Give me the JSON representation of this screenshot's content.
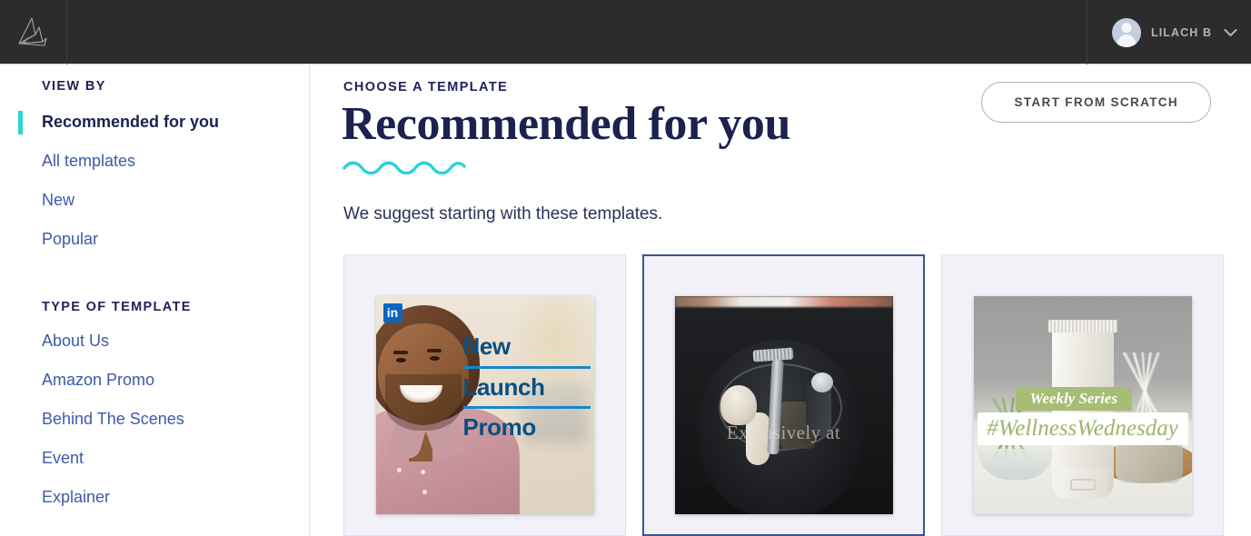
{
  "topbar": {
    "logo_icon": "paper-plane-logo",
    "user_name": "LILACH B",
    "chevron_icon": "chevron-down-icon",
    "avatar_icon": "user-avatar-placeholder"
  },
  "sidebar": {
    "view_by_heading": "VIEW BY",
    "view_by_items": [
      {
        "label": "Recommended for you",
        "active": true
      },
      {
        "label": "All templates",
        "active": false
      },
      {
        "label": "New",
        "active": false
      },
      {
        "label": "Popular",
        "active": false
      }
    ],
    "type_heading": "TYPE OF TEMPLATE",
    "type_items": [
      {
        "label": "About Us"
      },
      {
        "label": "Amazon Promo"
      },
      {
        "label": "Behind The Scenes"
      },
      {
        "label": "Event"
      },
      {
        "label": "Explainer"
      }
    ]
  },
  "main": {
    "eyebrow": "CHOOSE A TEMPLATE",
    "title": "Recommended for you",
    "subtitle": "We suggest starting with these templates.",
    "start_from_scratch_label": "START FROM SCRATCH"
  },
  "cards": [
    {
      "name": "new-launch-promo",
      "selected": false,
      "badge": "in",
      "badge_icon": "linkedin-icon",
      "text_lines": [
        "New",
        "Launch",
        "Promo"
      ]
    },
    {
      "name": "exclusively-at",
      "selected": true,
      "caption": "Exclusively at"
    },
    {
      "name": "wellness-wednesday",
      "selected": false,
      "band_text": "Weekly Series",
      "brush_text": "#WellnessWednesday"
    }
  ],
  "colors": {
    "topbar_bg": "#2c2c2c",
    "accent_teal": "#2bd6d6",
    "navy": "#1b2250",
    "link_blue": "#3d5aa8",
    "card_bg": "#f1f1f7",
    "selected_border": "#3b5397",
    "linkedin_blue": "#0a66c2",
    "wellness_green": "#a5bd74"
  }
}
